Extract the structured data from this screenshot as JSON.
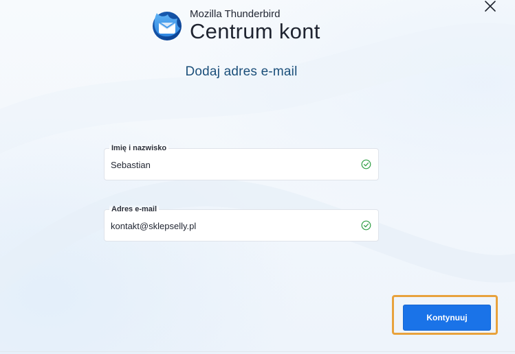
{
  "app": {
    "brand_sub": "Mozilla Thunderbird",
    "brand_title": "Centrum kont"
  },
  "page": {
    "heading": "Dodaj adres e-mail"
  },
  "form": {
    "name_field": {
      "label": "Imię i nazwisko",
      "value": "Sebastian",
      "valid_icon": "check-circle-icon"
    },
    "email_field": {
      "label": "Adres e-mail",
      "value": "kontakt@sklepselly.pl",
      "valid_icon": "check-circle-icon"
    }
  },
  "actions": {
    "continue_label": "Kontynuuj",
    "close_icon": "close-icon"
  },
  "colors": {
    "accent": "#1a73e8",
    "highlight_border": "#e8a23c",
    "heading": "#1b4f7a",
    "valid": "#2f9e44"
  }
}
